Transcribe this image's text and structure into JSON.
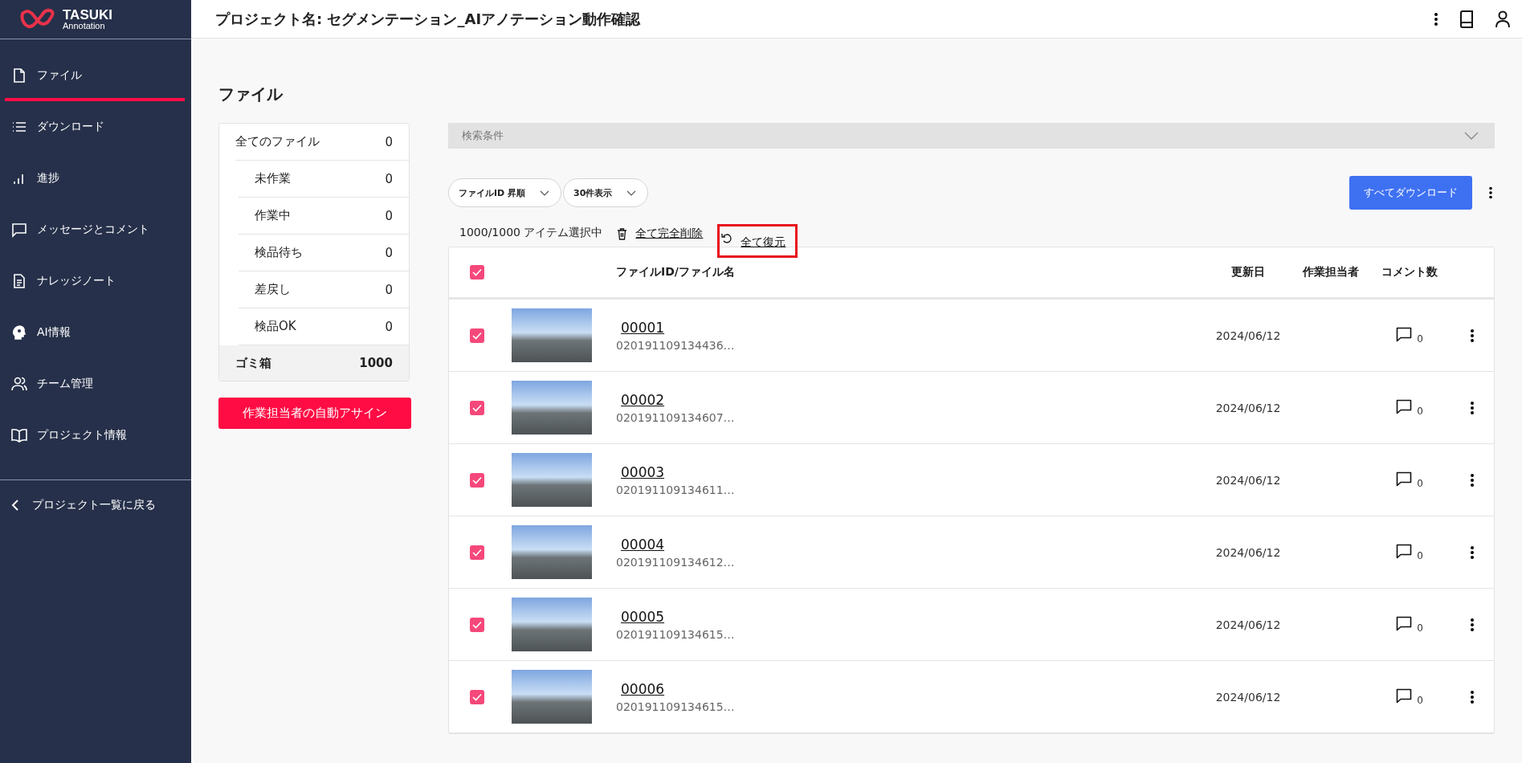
{
  "logo": {
    "name": "TASUKI",
    "sub": "Annotation"
  },
  "sidebar": {
    "items": [
      {
        "label": "ファイル",
        "selected": true
      },
      {
        "label": "ダウンロード",
        "selected": false
      },
      {
        "label": "進捗",
        "selected": false
      },
      {
        "label": "メッセージとコメント",
        "selected": false
      },
      {
        "label": "ナレッジノート",
        "selected": false
      },
      {
        "label": "AI情報",
        "selected": false
      },
      {
        "label": "チーム管理",
        "selected": false
      },
      {
        "label": "プロジェクト情報",
        "selected": false
      }
    ],
    "back_link": "プロジェクト一覧に戻る"
  },
  "header": {
    "title": "プロジェクト名: セグメンテーション_AIアノテーション動作確認"
  },
  "page_title": "ファイル",
  "status_filter": [
    {
      "label": "全てのファイル",
      "count": "0",
      "selected": false,
      "children": [
        {
          "label": "未作業",
          "count": "0",
          "selected": false
        },
        {
          "label": "作業中",
          "count": "0",
          "selected": false
        },
        {
          "label": "検品待ち",
          "count": "0",
          "selected": false
        },
        {
          "label": "差戻し",
          "count": "0",
          "selected": false
        },
        {
          "label": "検品OK",
          "count": "0",
          "selected": false
        }
      ]
    },
    {
      "label": "ゴミ箱",
      "count": "1000",
      "selected": true
    }
  ],
  "auto_assign_button": "作業担当者の自動アサイン",
  "search_panel": {
    "label": "検索条件",
    "expanded": false
  },
  "dropdowns": [
    {
      "value": "ファイルID 昇順"
    },
    {
      "value": "30件表示"
    }
  ],
  "download_all_button": "すべてダウンロード",
  "selection": {
    "text": "1000/1000 アイテム選択中",
    "actions": [
      {
        "kind": "delete",
        "label": "全て完全削除",
        "highlighted": false
      },
      {
        "kind": "restore",
        "label": "全て復元",
        "highlighted": true
      }
    ]
  },
  "table": {
    "select_all_checked": true,
    "columns": [
      "ファイルID/ファイル名",
      "更新日",
      "作業担当者",
      "コメント数"
    ],
    "rows": [
      {
        "checked": true,
        "id": "00001",
        "filename": "020191109134436…",
        "updated": "2024/06/12",
        "comments": "0"
      },
      {
        "checked": true,
        "id": "00002",
        "filename": "020191109134607…",
        "updated": "2024/06/12",
        "comments": "0"
      },
      {
        "checked": true,
        "id": "00003",
        "filename": "020191109134611…",
        "updated": "2024/06/12",
        "comments": "0"
      },
      {
        "checked": true,
        "id": "00004",
        "filename": "020191109134612…",
        "updated": "2024/06/12",
        "comments": "0"
      },
      {
        "checked": true,
        "id": "00005",
        "filename": "020191109134615…",
        "updated": "2024/06/12",
        "comments": "0"
      },
      {
        "checked": true,
        "id": "00006",
        "filename": "020191109134615…",
        "updated": "2024/06/12",
        "comments": "0"
      }
    ]
  }
}
